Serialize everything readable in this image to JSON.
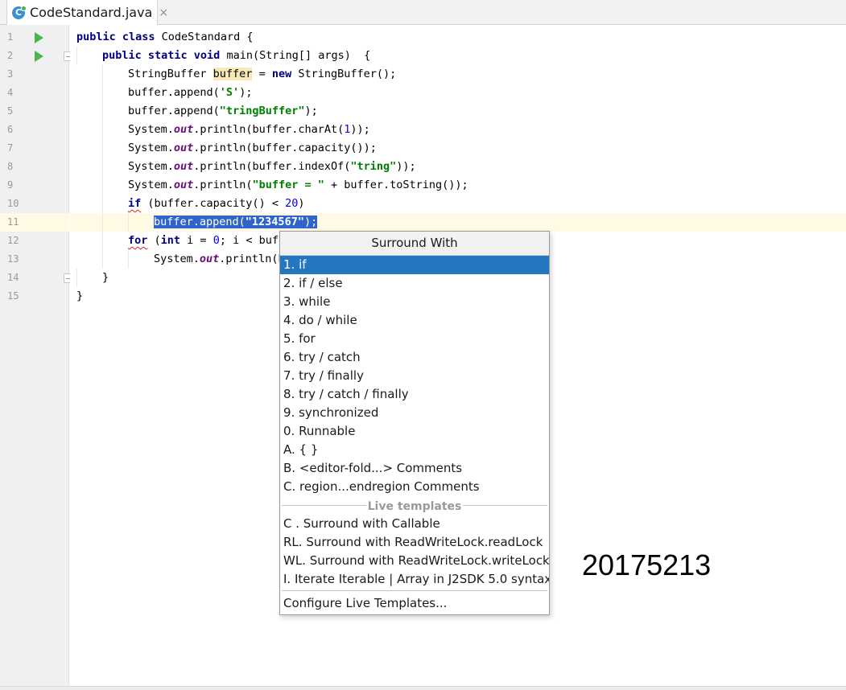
{
  "tab": {
    "label": "CodeStandard.java",
    "close": "×",
    "icon": "java-class-icon"
  },
  "editor": {
    "line_numbers": [
      "1",
      "2",
      "3",
      "4",
      "5",
      "6",
      "7",
      "8",
      "9",
      "10",
      "11",
      "12",
      "13",
      "14",
      "15"
    ]
  },
  "popup": {
    "title": "Surround With",
    "items": [
      "1. if",
      "2. if / else",
      "3. while",
      "4. do / while",
      "5. for",
      "6. try / catch",
      "7. try / finally",
      "8. try / catch / finally",
      "9. synchronized",
      "0. Runnable",
      "A. { }",
      "B. <editor-fold...> Comments",
      "C. region...endregion Comments"
    ],
    "selected_index": 0,
    "live_templates_label": "Live templates",
    "live_items": [
      "C . Surround with Callable",
      "RL. Surround with ReadWriteLock.readLock",
      "WL. Surround with ReadWriteLock.writeLock",
      "I. Iterate Iterable | Array in J2SDK 5.0 syntax"
    ],
    "configure": "Configure Live Templates..."
  },
  "overlay_text": "20175213",
  "colors": {
    "keyword": "#000080",
    "string": "#008000",
    "number": "#0000ff",
    "field": "#660e7a",
    "selection": "#2f65ca",
    "popup_selection": "#2675bf",
    "run_icon": "#4db34d"
  }
}
